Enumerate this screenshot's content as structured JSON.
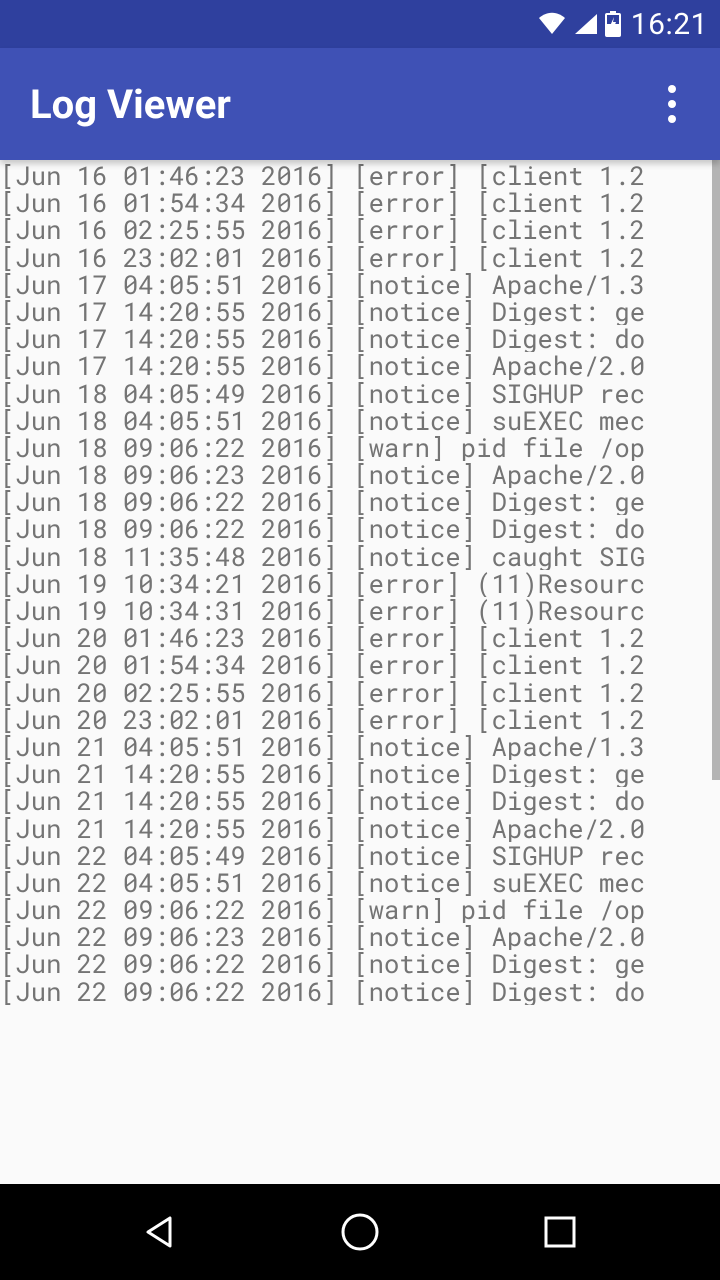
{
  "status": {
    "time": "16:21"
  },
  "appbar": {
    "title": "Log Viewer"
  },
  "logs": [
    "[Jun 16 01:46:23 2016] [error] [client 1.2",
    "[Jun 16 01:54:34 2016] [error] [client 1.2",
    "[Jun 16 02:25:55 2016] [error] [client 1.2",
    "[Jun 16 23:02:01 2016] [error] [client 1.2",
    "[Jun 17 04:05:51 2016] [notice] Apache/1.3",
    "[Jun 17 14:20:55 2016] [notice] Digest: ge",
    "[Jun 17 14:20:55 2016] [notice] Digest: do",
    "[Jun 17 14:20:55 2016] [notice] Apache/2.0",
    "[Jun 18 04:05:49 2016] [notice] SIGHUP rec",
    "[Jun 18 04:05:51 2016] [notice] suEXEC mec",
    "[Jun 18 09:06:22 2016] [warn] pid file /op",
    "[Jun 18 09:06:23 2016] [notice] Apache/2.0",
    "[Jun 18 09:06:22 2016] [notice] Digest: ge",
    "[Jun 18 09:06:22 2016] [notice] Digest: do",
    "[Jun 18 11:35:48 2016] [notice] caught SIG",
    "[Jun 19 10:34:21 2016] [error] (11)Resourc",
    "[Jun 19 10:34:31 2016] [error] (11)Resourc",
    "[Jun 20 01:46:23 2016] [error] [client 1.2",
    "[Jun 20 01:54:34 2016] [error] [client 1.2",
    "[Jun 20 02:25:55 2016] [error] [client 1.2",
    "[Jun 20 23:02:01 2016] [error] [client 1.2",
    "[Jun 21 04:05:51 2016] [notice] Apache/1.3",
    "[Jun 21 14:20:55 2016] [notice] Digest: ge",
    "[Jun 21 14:20:55 2016] [notice] Digest: do",
    "[Jun 21 14:20:55 2016] [notice] Apache/2.0",
    "[Jun 22 04:05:49 2016] [notice] SIGHUP rec",
    "[Jun 22 04:05:51 2016] [notice] suEXEC mec",
    "[Jun 22 09:06:22 2016] [warn] pid file /op",
    "[Jun 22 09:06:23 2016] [notice] Apache/2.0",
    "[Jun 22 09:06:22 2016] [notice] Digest: ge",
    "[Jun 22 09:06:22 2016] [notice] Digest: do"
  ]
}
